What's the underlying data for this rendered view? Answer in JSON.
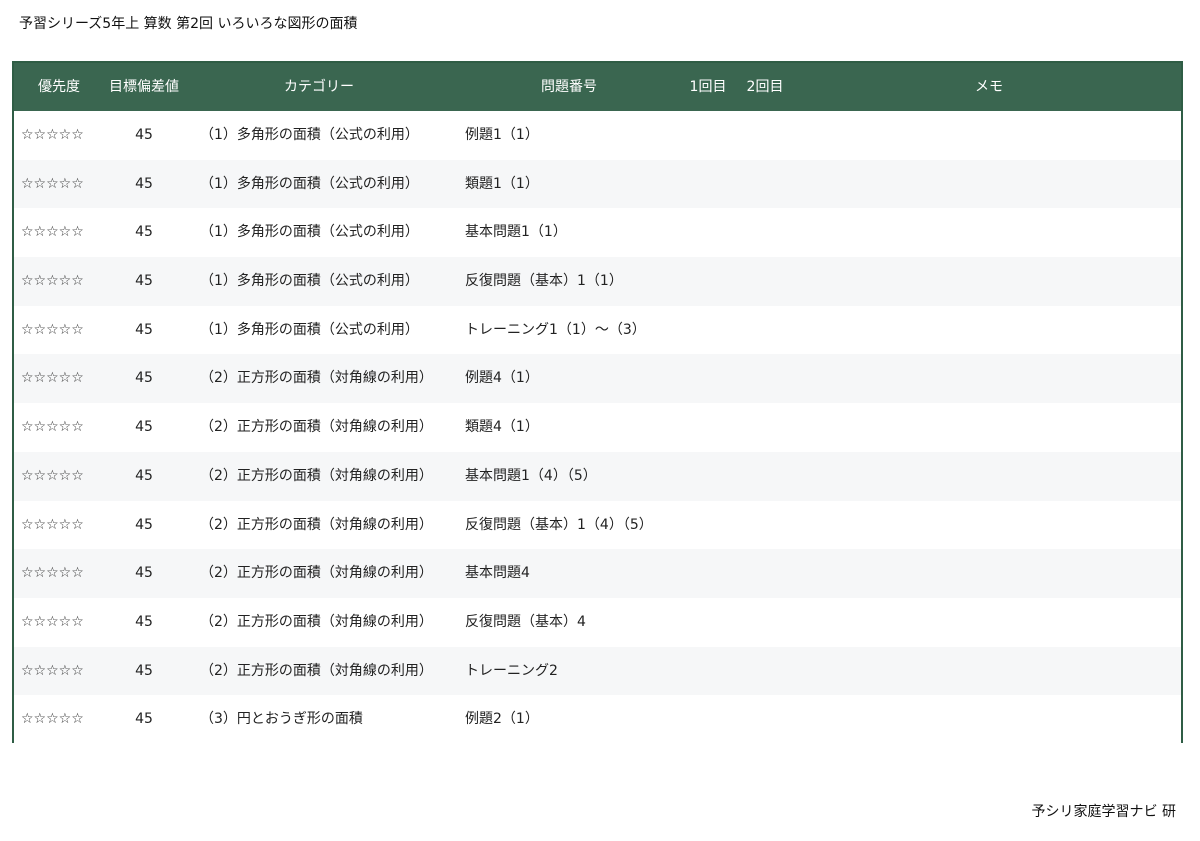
{
  "document": {
    "title": "予習シリーズ5年上 算数 第2回 いろいろな図形の面積",
    "footer": "予シリ家庭学習ナビ 研"
  },
  "colors": {
    "header_bg": "#3a6650",
    "border": "#2f5d45",
    "row_alt_bg": "#f6f7f8"
  },
  "table": {
    "headers": {
      "priority": "優先度",
      "target": "目標偏差値",
      "category": "カテゴリー",
      "problem": "問題番号",
      "first": "1回目",
      "second": "2回目",
      "memo": "メモ"
    },
    "rows": [
      {
        "stars": "☆☆☆☆☆",
        "target": "45",
        "category": "（1）多角形の面積（公式の利用）",
        "problem": "例題1（1）"
      },
      {
        "stars": "☆☆☆☆☆",
        "target": "45",
        "category": "（1）多角形の面積（公式の利用）",
        "problem": "類題1（1）"
      },
      {
        "stars": "☆☆☆☆☆",
        "target": "45",
        "category": "（1）多角形の面積（公式の利用）",
        "problem": "基本問題1（1）"
      },
      {
        "stars": "☆☆☆☆☆",
        "target": "45",
        "category": "（1）多角形の面積（公式の利用）",
        "problem": "反復問題（基本）1（1）"
      },
      {
        "stars": "☆☆☆☆☆",
        "target": "45",
        "category": "（1）多角形の面積（公式の利用）",
        "problem": "トレーニング1（1）〜（3）"
      },
      {
        "stars": "☆☆☆☆☆",
        "target": "45",
        "category": "（2）正方形の面積（対角線の利用）",
        "problem": "例題4（1）"
      },
      {
        "stars": "☆☆☆☆☆",
        "target": "45",
        "category": "（2）正方形の面積（対角線の利用）",
        "problem": "類題4（1）"
      },
      {
        "stars": "☆☆☆☆☆",
        "target": "45",
        "category": "（2）正方形の面積（対角線の利用）",
        "problem": "基本問題1（4）（5）"
      },
      {
        "stars": "☆☆☆☆☆",
        "target": "45",
        "category": "（2）正方形の面積（対角線の利用）",
        "problem": "反復問題（基本）1（4）（5）"
      },
      {
        "stars": "☆☆☆☆☆",
        "target": "45",
        "category": "（2）正方形の面積（対角線の利用）",
        "problem": "基本問題4"
      },
      {
        "stars": "☆☆☆☆☆",
        "target": "45",
        "category": "（2）正方形の面積（対角線の利用）",
        "problem": "反復問題（基本）4"
      },
      {
        "stars": "☆☆☆☆☆",
        "target": "45",
        "category": "（2）正方形の面積（対角線の利用）",
        "problem": "トレーニング2"
      },
      {
        "stars": "☆☆☆☆☆",
        "target": "45",
        "category": "（3）円とおうぎ形の面積",
        "problem": "例題2（1）"
      }
    ]
  }
}
